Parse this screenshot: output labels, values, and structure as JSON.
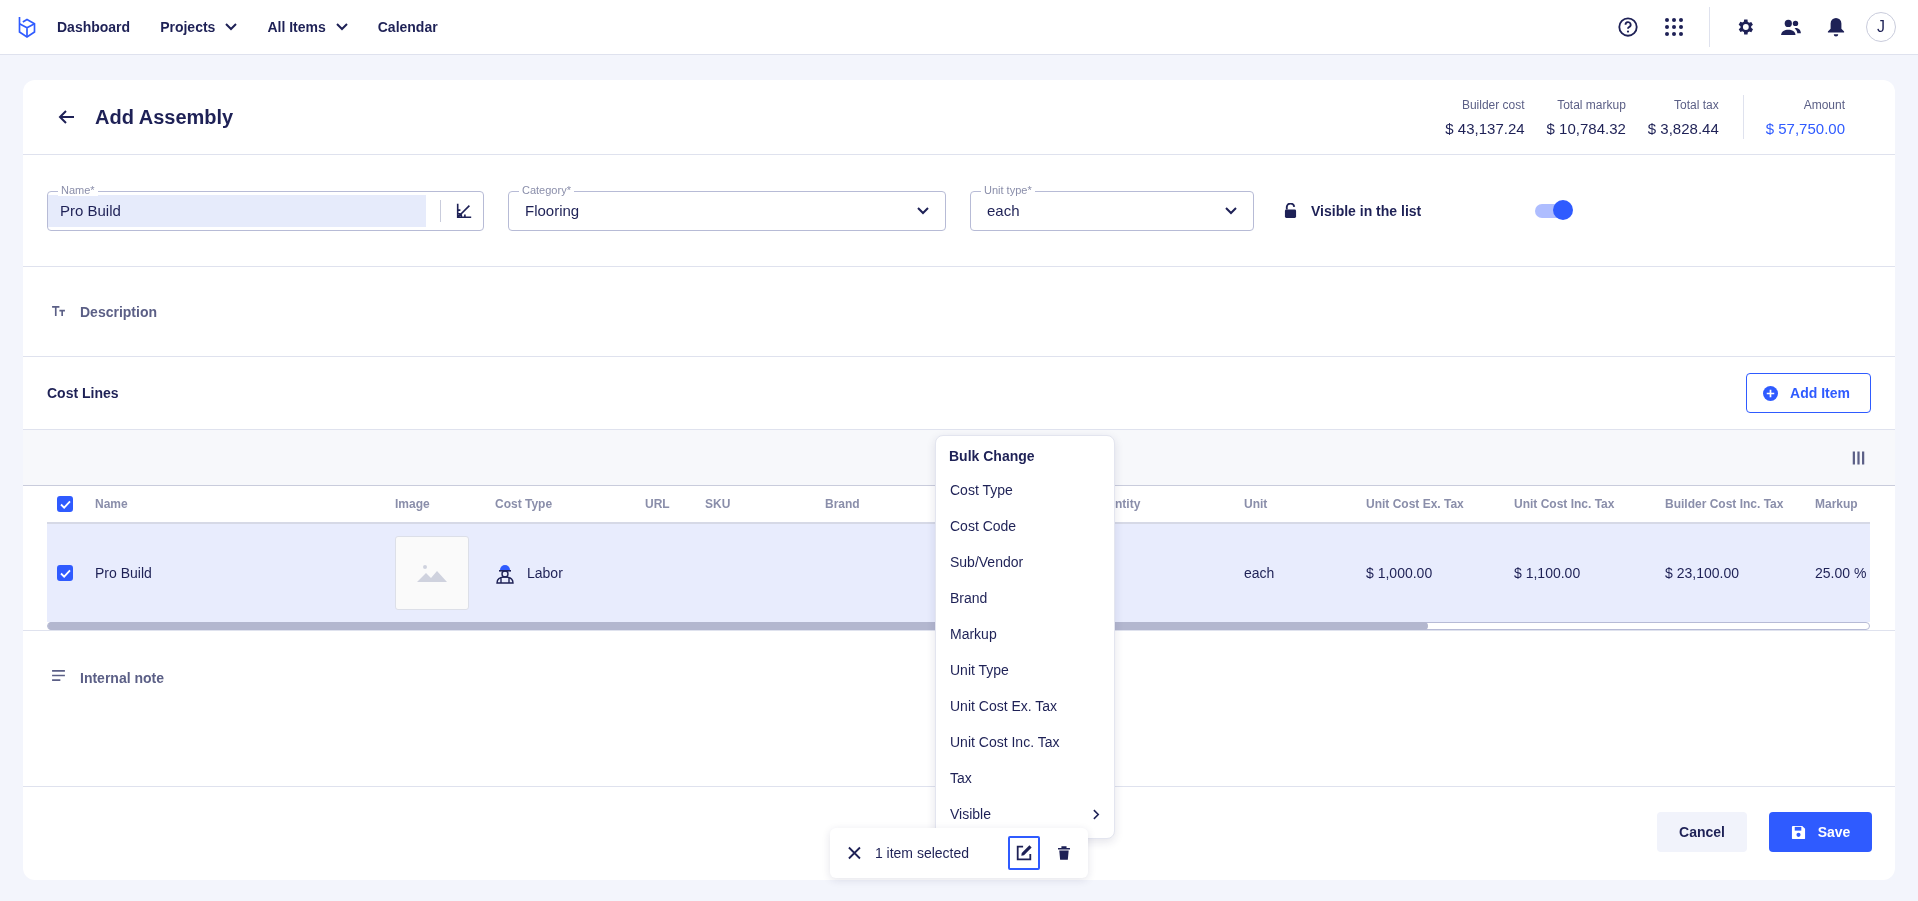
{
  "nav": {
    "links": [
      {
        "label": "Dashboard",
        "dropdown": false
      },
      {
        "label": "Projects",
        "dropdown": true
      },
      {
        "label": "All Items",
        "dropdown": true
      },
      {
        "label": "Calendar",
        "dropdown": false
      }
    ],
    "avatar": "J"
  },
  "header": {
    "title": "Add Assembly",
    "totals": [
      {
        "label": "Builder cost",
        "value": "$ 43,137.24",
        "kind": "plain"
      },
      {
        "label": "Total markup",
        "value": "$ 10,784.32",
        "kind": "plain"
      },
      {
        "label": "Total tax",
        "value": "$ 3,828.44",
        "kind": "plain"
      },
      {
        "label": "Amount",
        "value": "$ 57,750.00",
        "kind": "total"
      }
    ]
  },
  "form": {
    "name": {
      "label": "Name*",
      "value": "Pro Build"
    },
    "category": {
      "label": "Category*",
      "value": "Flooring"
    },
    "unit_type": {
      "label": "Unit type*",
      "value": "each"
    },
    "visible": {
      "label": "Visible in the list",
      "on": true
    }
  },
  "description": {
    "label": "Description"
  },
  "cost_lines": {
    "title": "Cost Lines",
    "add_button": "Add Item",
    "table": {
      "all_checked": true,
      "columns": [
        "Name",
        "Image",
        "Cost Type",
        "URL",
        "SKU",
        "Brand",
        "ntity",
        "Unit",
        "Unit Cost Ex. Tax",
        "Unit Cost Inc. Tax",
        "Builder Cost Inc. Tax",
        "Markup"
      ],
      "rows": [
        {
          "selected": true,
          "name": "Pro Build",
          "cost_type": "Labor",
          "unit": "each",
          "unit_cost_ex_tax": "$ 1,000.00",
          "unit_cost_inc_tax": "$ 1,100.00",
          "builder_cost_inc_tax": "$ 23,100.00",
          "markup": "25.00 %"
        }
      ]
    }
  },
  "internal_note": {
    "label": "Internal note"
  },
  "bulk_menu": {
    "title": "Bulk Change",
    "items": [
      {
        "label": "Cost Type",
        "submenu": false
      },
      {
        "label": "Cost Code",
        "submenu": false
      },
      {
        "label": "Sub/Vendor",
        "submenu": false
      },
      {
        "label": "Brand",
        "submenu": false
      },
      {
        "label": "Markup",
        "submenu": false
      },
      {
        "label": "Unit Type",
        "submenu": false
      },
      {
        "label": "Unit Cost Ex. Tax",
        "submenu": false
      },
      {
        "label": "Unit Cost Inc. Tax",
        "submenu": false
      },
      {
        "label": "Tax",
        "submenu": false
      },
      {
        "label": "Visible",
        "submenu": true
      }
    ]
  },
  "selection_bar": {
    "text": "1 item selected"
  },
  "footer": {
    "cancel": "Cancel",
    "save": "Save"
  }
}
